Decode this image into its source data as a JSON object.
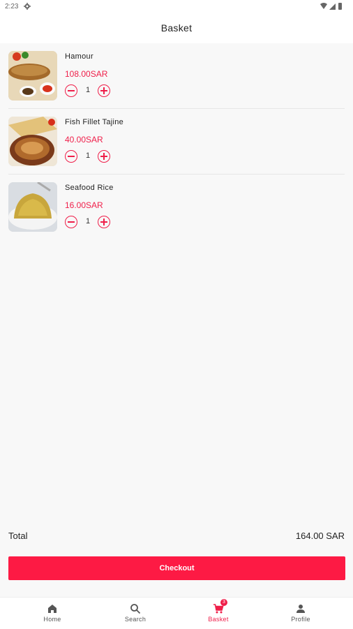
{
  "status_bar": {
    "time": "2:23"
  },
  "header": {
    "title": "Basket"
  },
  "items": [
    {
      "name": "Hamour",
      "price": "108.00SAR",
      "quantity": "1"
    },
    {
      "name": "Fish Fillet Tajine",
      "price": "40.00SAR",
      "quantity": "1"
    },
    {
      "name": "Seafood Rice",
      "price": "16.00SAR",
      "quantity": "1"
    }
  ],
  "summary": {
    "total_label": "Total",
    "total_value": "164.00 SAR"
  },
  "checkout": {
    "label": "Checkout"
  },
  "nav": {
    "home": "Home",
    "search": "Search",
    "basket": "Basket",
    "basket_count": "3",
    "profile": "Profile"
  },
  "colors": {
    "accent": "#ef1e49",
    "background": "#f8f8f8"
  }
}
